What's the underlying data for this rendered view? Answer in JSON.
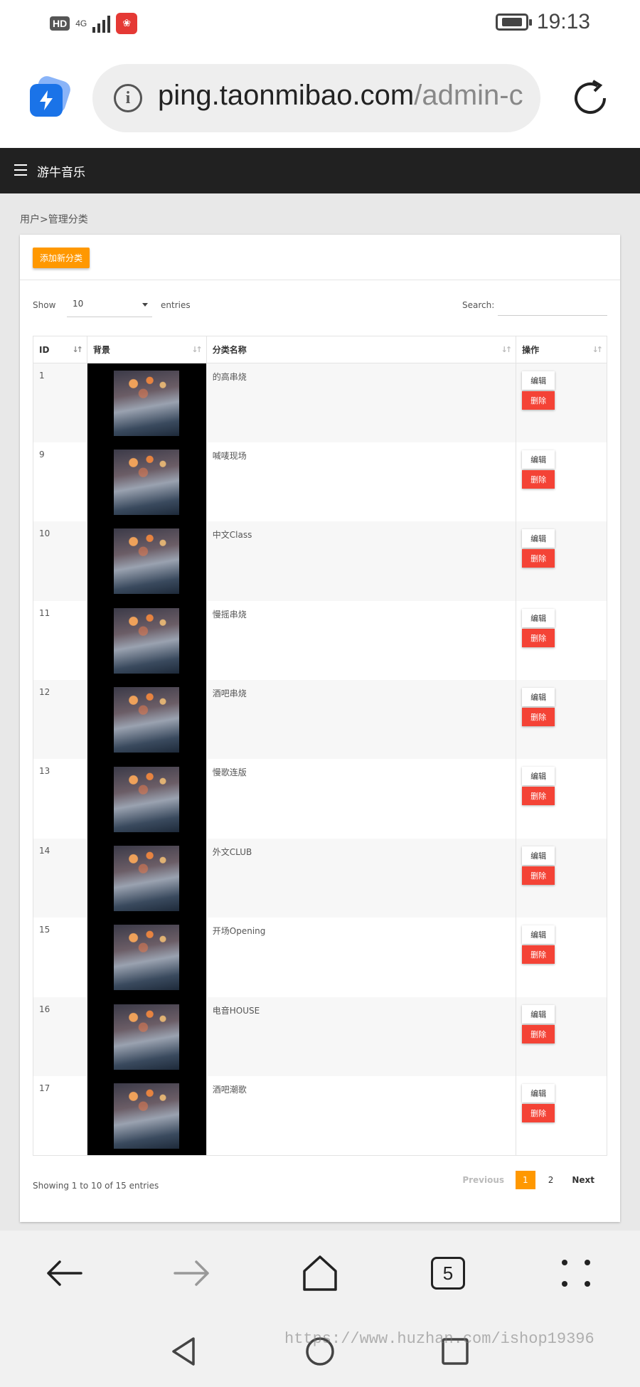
{
  "status_bar": {
    "hd": "HD",
    "network": "4G",
    "time": "19:13",
    "app_badge_icon": "app-notification-icon"
  },
  "browser": {
    "url_host": "ping.taonmibao.com",
    "url_rest": "/admin-c",
    "tab_count": "5"
  },
  "nav": {
    "brand": "游牛音乐"
  },
  "breadcrumb": "用户>管理分类",
  "toolbar": {
    "add_label": "添加新分类"
  },
  "controls": {
    "show_label": "Show",
    "page_length": "10",
    "entries_label": "entries",
    "search_label": "Search:",
    "search_value": ""
  },
  "table": {
    "headers": [
      "ID",
      "背景",
      "分类名称",
      "操作"
    ],
    "edit_label": "编辑",
    "delete_label": "删除",
    "rows": [
      {
        "id": "1",
        "name": "的高串烧"
      },
      {
        "id": "9",
        "name": "喊唛现场"
      },
      {
        "id": "10",
        "name": "中文Class"
      },
      {
        "id": "11",
        "name": "慢摇串烧"
      },
      {
        "id": "12",
        "name": "酒吧串烧"
      },
      {
        "id": "13",
        "name": "慢歌连版"
      },
      {
        "id": "14",
        "name": "外文CLUB"
      },
      {
        "id": "15",
        "name": "开场Opening"
      },
      {
        "id": "16",
        "name": "电音HOUSE"
      },
      {
        "id": "17",
        "name": "酒吧潮歌"
      }
    ]
  },
  "footer": {
    "info": "Showing 1 to 10 of 15 entries",
    "previous": "Previous",
    "pages": [
      "1",
      "2"
    ],
    "active_page": "1",
    "next": "Next"
  },
  "watermark": "https://www.huzhan.com/ishop19396",
  "colors": {
    "accent": "#ff9800",
    "danger": "#f44336",
    "navbar": "#212121"
  }
}
